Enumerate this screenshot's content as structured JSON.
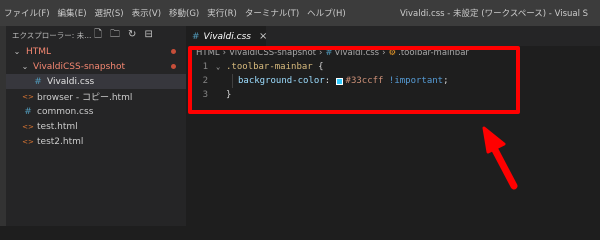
{
  "menubar": {
    "items": [
      "ファイル(F)",
      "編集(E)",
      "選択(S)",
      "表示(V)",
      "移動(G)",
      "実行(R)",
      "ターミナル(T)",
      "ヘルプ(H)"
    ],
    "window_title": "Vivaldi.css - 未設定 (ワークスペース) - Visual S"
  },
  "sidebar": {
    "header_label": "エクスプローラー: 未...",
    "tools": [
      "new-file",
      "new-folder",
      "refresh",
      "collapse"
    ],
    "tree": [
      {
        "label": "HTML",
        "chevron": "v",
        "icon": "",
        "modified": true
      },
      {
        "label": "VivaldiCSS-snapshot",
        "chevron": ">",
        "icon": "",
        "modified": true
      },
      {
        "label": "Vivaldi.css",
        "icon": "#",
        "selected": true
      },
      {
        "label": "browser - コピー.html",
        "icon": "<>"
      },
      {
        "label": "common.css",
        "icon": "#"
      },
      {
        "label": "test.html",
        "icon": "<>"
      },
      {
        "label": "test2.html",
        "icon": "<>"
      }
    ]
  },
  "editor": {
    "tab": {
      "icon": "#",
      "label": "Vivaldi.css",
      "close": "×"
    },
    "breadcrumb": [
      "HTML",
      "VivaldiCSS-snapshot",
      "Vivaldi.css",
      ".toolbar-mainbar"
    ],
    "lines": [
      {
        "num": "1",
        "selector": ".toolbar-mainbar",
        "brace": " {"
      },
      {
        "num": "2",
        "property": "background-color",
        "colon": ": ",
        "value": "#33ccff",
        "important": " !important",
        "semi": ";"
      },
      {
        "num": "3",
        "brace": "}"
      }
    ]
  },
  "colors": {
    "swatch": "#33ccff",
    "annotation": "#ff0000"
  }
}
